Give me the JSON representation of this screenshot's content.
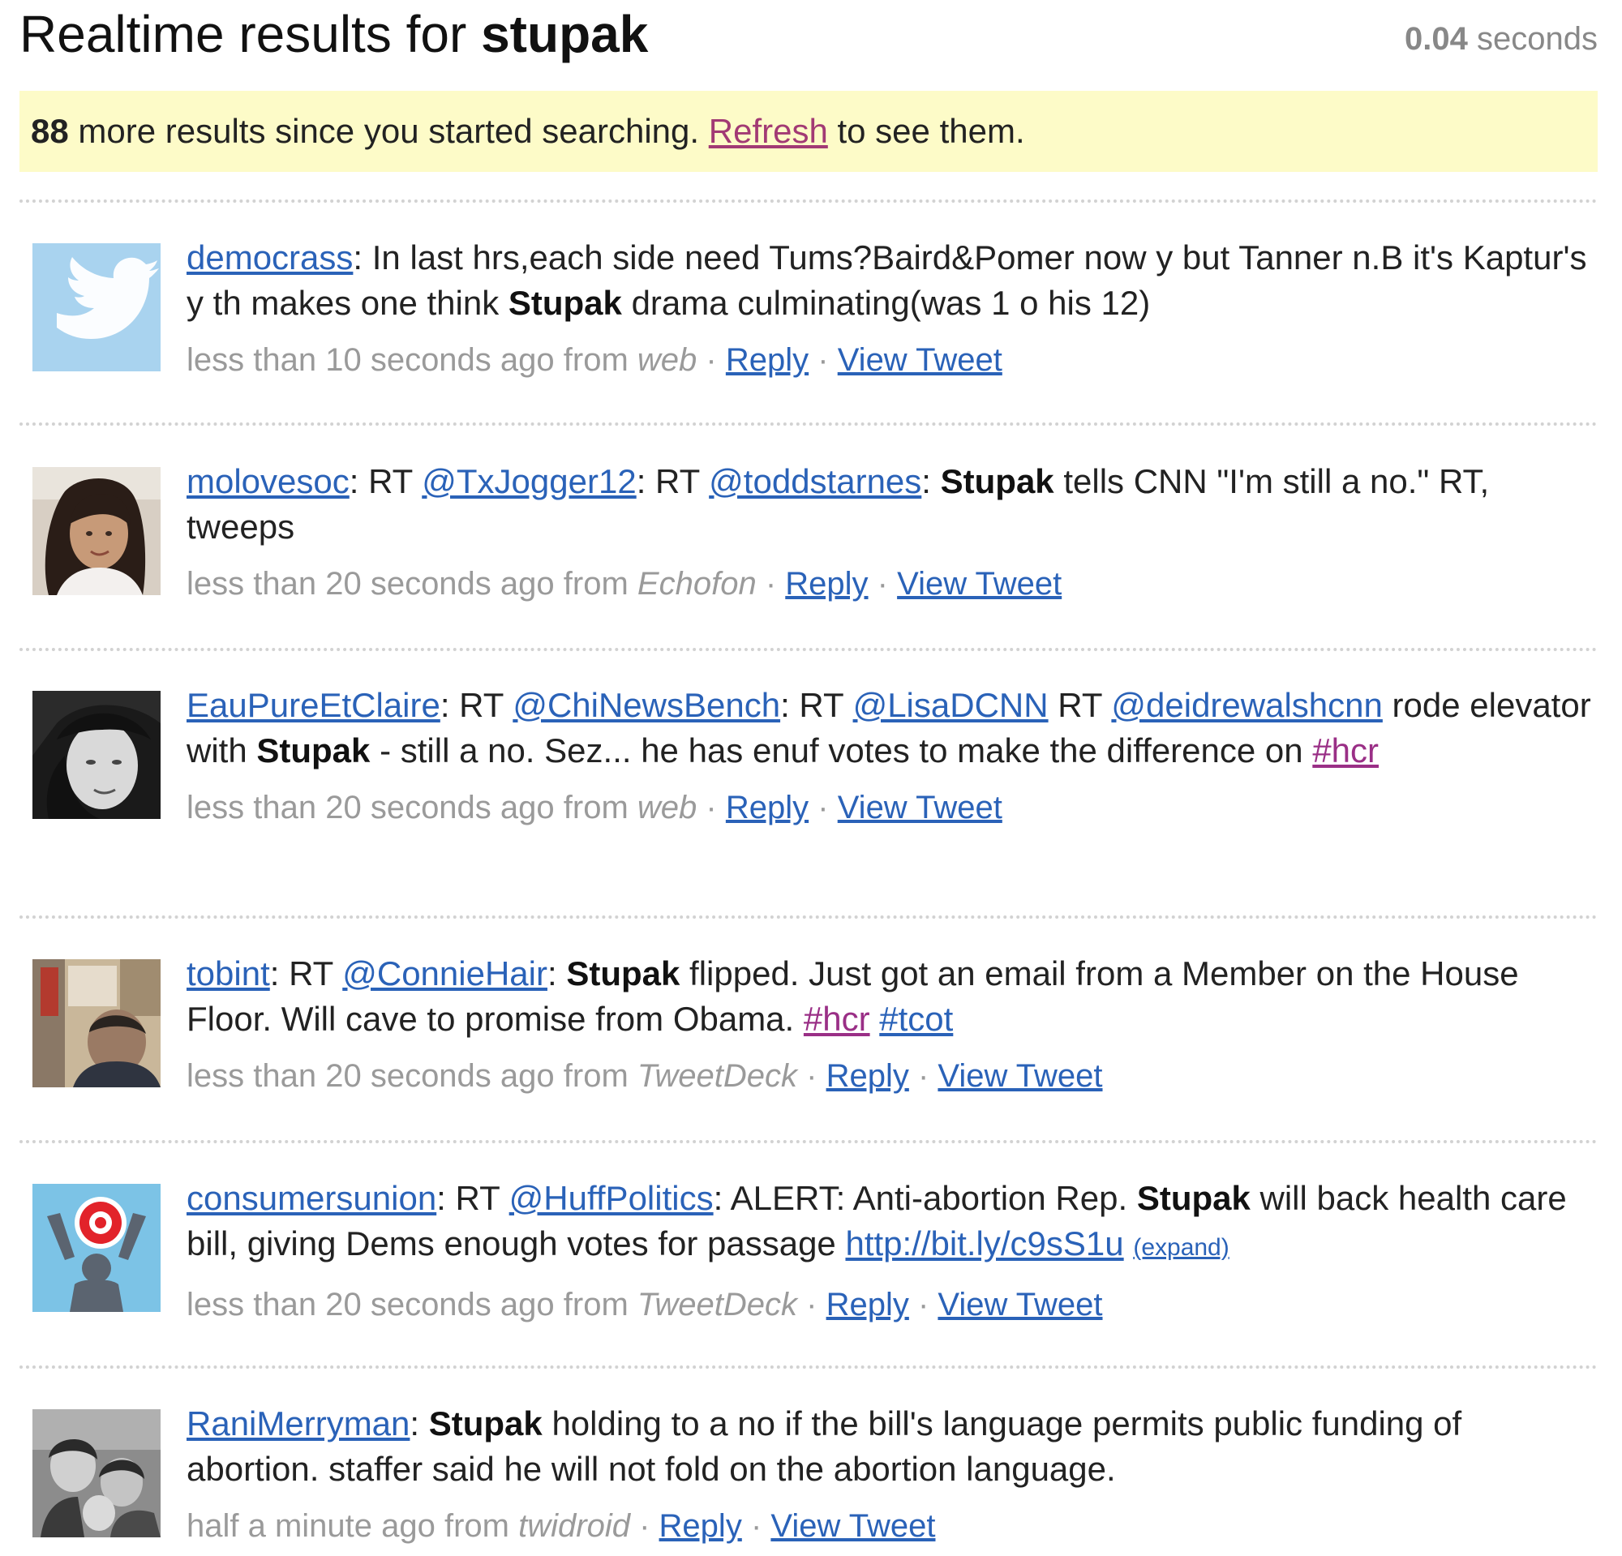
{
  "header": {
    "title_prefix": "Realtime results for",
    "query": "stupak",
    "timing_value": "0.04",
    "timing_unit": "seconds"
  },
  "notice": {
    "count": "88",
    "text_before": "more results since you started searching.",
    "refresh_label": "Refresh",
    "text_after": "to see them."
  },
  "colors": {
    "notice_background": "#fdfbc8",
    "link": "#2a62b8",
    "hashtag": "#9a2f86",
    "meta_gray": "#9a9a9a"
  },
  "meta_labels": {
    "from": "from",
    "reply": "Reply",
    "view_tweet": "View Tweet",
    "separator": "·"
  },
  "tweets": [
    {
      "user": "democrass",
      "text_a": "In last hrs,each side need Tums?Baird&Pomer now y but Tanner n.B it's Kaptur's y th makes one think",
      "keyword": "Stupak",
      "text_b": "drama culminating(was 1 o his 12)",
      "time": "less than 10 seconds ago",
      "source": "web",
      "avatar": "twitter-bird"
    },
    {
      "user": "molovesoc",
      "rt_1": "RT",
      "mention_1": "@TxJogger12",
      "rt_2": ": RT",
      "mention_2": "@toddstarnes",
      "keyword": "Stupak",
      "text_b": "tells CNN \"I'm still a no.\" RT, tweeps",
      "time": "less than 20 seconds ago",
      "source": "Echofon",
      "avatar": "user-photo"
    },
    {
      "user": "EauPureEtClaire",
      "rt_1": "RT",
      "mention_1": "@ChiNewsBench",
      "rt_2": ": RT",
      "mention_2": "@LisaDCNN",
      "rt_3": "RT",
      "mention_3": "@deidrewalshcnn",
      "text_a": "rode elevator with",
      "keyword": "Stupak",
      "text_b": "- still a no. Sez... he has enuf votes to make the difference on",
      "hashtag_1": "#hcr",
      "time": "less than 20 seconds ago",
      "source": "web",
      "avatar": "user-photo"
    },
    {
      "user": "tobint",
      "rt_1": "RT",
      "mention_1": "@ConnieHair",
      "keyword": "Stupak",
      "text_b": "flipped. Just got an email from a Member on the House Floor. Will cave to promise from Obama.",
      "hashtag_1": "#hcr",
      "hashtag_2": "#tcot",
      "time": "less than 20 seconds ago",
      "source": "TweetDeck",
      "avatar": "user-photo"
    },
    {
      "user": "consumersunion",
      "rt_1": "RT",
      "mention_1": "@HuffPolitics",
      "text_a": ": ALERT: Anti-abortion Rep.",
      "keyword": "Stupak",
      "text_b": "will back health care bill, giving Dems enough votes for passage",
      "link": "http://bit.ly/c9sS1u",
      "expand": "(expand)",
      "time": "less than 20 seconds ago",
      "source": "TweetDeck",
      "avatar": "consumers-union-logo"
    },
    {
      "user": "RaniMerryman",
      "keyword": "Stupak",
      "text_b": "holding to a no if the bill's language permits public funding of abortion. staffer said he will not fold on the abortion language.",
      "time": "half a minute ago",
      "source": "twidroid",
      "avatar": "user-photo"
    }
  ]
}
